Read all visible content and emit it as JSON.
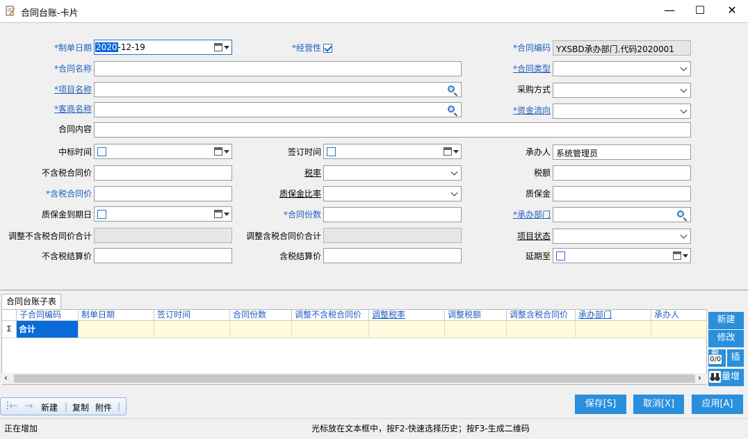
{
  "window": {
    "title": "合同台账-卡片",
    "minimize": "—",
    "maximize": "☐",
    "close": "✕"
  },
  "form": {
    "date": {
      "label": "*制单日期",
      "year": "2020",
      "rest": "-12-19"
    },
    "operating": {
      "label": "*经营性",
      "checked": true
    },
    "contract_code": {
      "label": "*合同编码",
      "value": "YXSBD承办部门.代码2020001"
    },
    "contract_name": {
      "label": "*合同名称",
      "value": ""
    },
    "contract_type": {
      "label": "*合同类型",
      "value": ""
    },
    "project_name": {
      "label": "*项目名称",
      "value": ""
    },
    "purchase_method": {
      "label": "采购方式",
      "value": ""
    },
    "customer_name": {
      "label": "*客商名称",
      "value": ""
    },
    "fund_flow": {
      "label": "*资金流向",
      "value": ""
    },
    "contract_content": {
      "label": "合同内容",
      "value": ""
    },
    "bid_time": {
      "label": "中标时间"
    },
    "sign_time": {
      "label": "签订时间"
    },
    "handler": {
      "label": "承办人",
      "value": "系统管理员"
    },
    "price_ex_tax": {
      "label": "不含税合同价",
      "value": ""
    },
    "tax_rate": {
      "label": "税率",
      "value": ""
    },
    "tax_amount": {
      "label": "税额",
      "value": ""
    },
    "price_inc_tax": {
      "label": "*含税合同价",
      "value": ""
    },
    "retention_ratio": {
      "label": "质保金比率",
      "value": ""
    },
    "retention": {
      "label": "质保金",
      "value": ""
    },
    "retention_due": {
      "label": "质保金到期日"
    },
    "copies": {
      "label": "*合同份数",
      "value": ""
    },
    "dept": {
      "label": "*承办部门",
      "value": ""
    },
    "adj_ex_total": {
      "label": "调整不含税合同价合计",
      "value": ""
    },
    "adj_inc_total": {
      "label": "调整含税合同价合计",
      "value": ""
    },
    "project_status": {
      "label": "项目状态",
      "value": ""
    },
    "settle_ex": {
      "label": "不含税结算价",
      "value": ""
    },
    "settle_inc": {
      "label": "含税结算价",
      "value": ""
    },
    "extend_to": {
      "label": "延期至"
    }
  },
  "subtable": {
    "tab": "合同台账子表",
    "columns": [
      "子合同编码",
      "制单日期",
      "签订时间",
      "合同份数",
      "调整不含税合同价",
      "调整税率",
      "调整税额",
      "调整含税合同价",
      "承办部门",
      "承办人"
    ],
    "sum_symbol": "Σ",
    "sum_label": "合计",
    "side_buttons": {
      "new": "新建",
      "edit": "修改",
      "del": "删",
      "ins": "插",
      "count": "0/0",
      "batch": "量增"
    }
  },
  "toolbar": {
    "new": "新建",
    "copy": "复制",
    "attach": "附件"
  },
  "actions": {
    "save": "保存[S]",
    "cancel": "取消[X]",
    "apply": "应用[A]"
  },
  "status": {
    "left": "正在增加",
    "hint": "光标放在文本框中，按F2-快速选择历史；按F3-生成二维码"
  },
  "colors": {
    "accent": "#2a8fdc",
    "label_blue": "#1f5fbf",
    "grid_sum": "#fffbdc"
  }
}
